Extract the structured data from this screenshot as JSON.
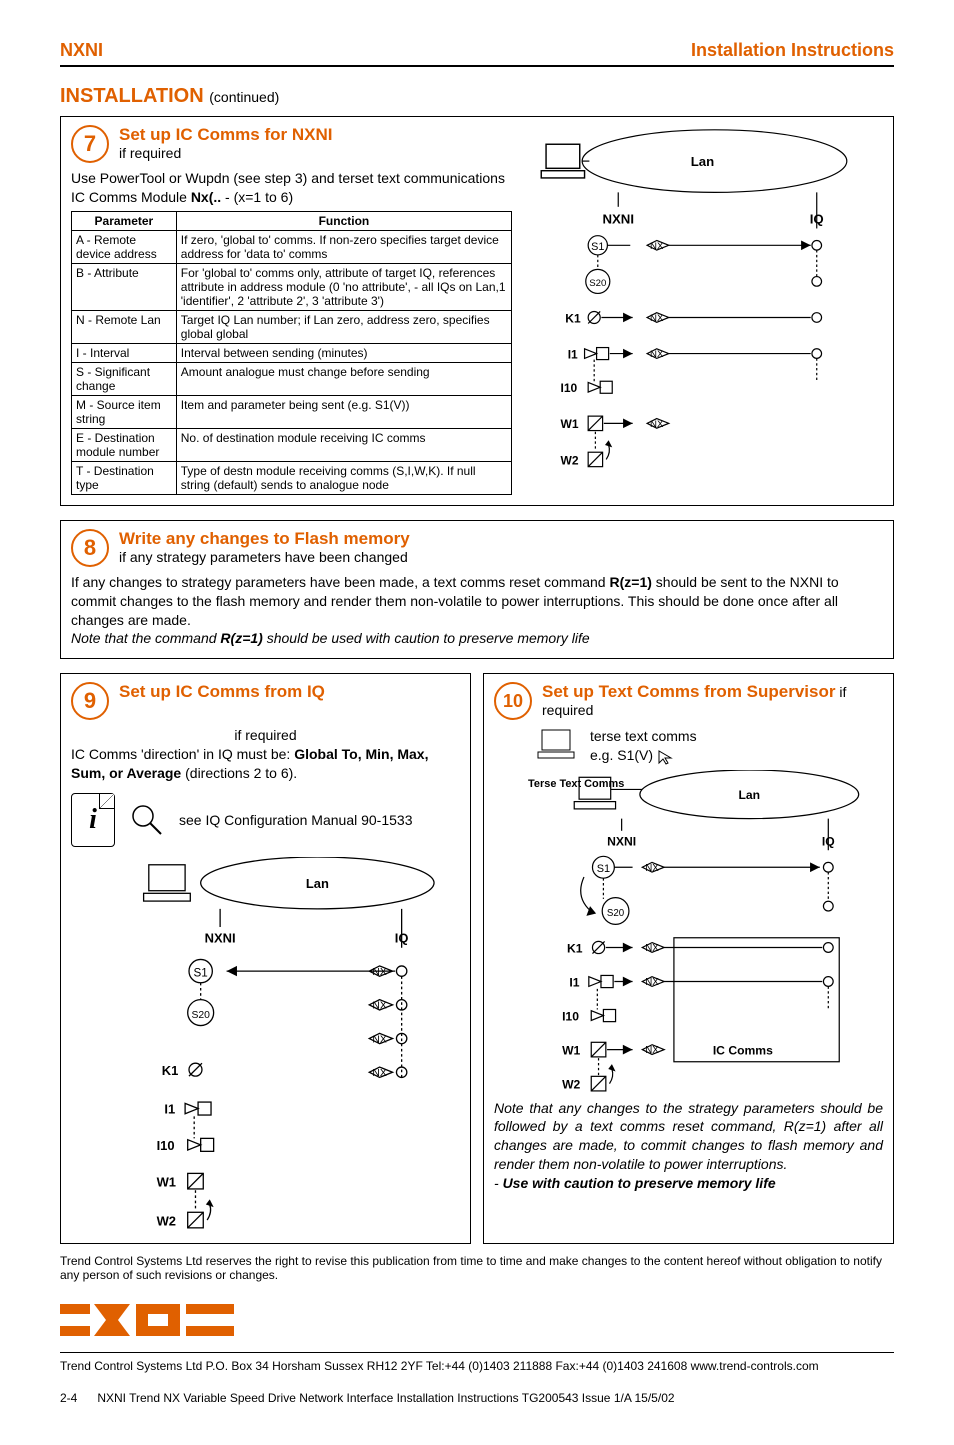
{
  "header": {
    "left": "NXNI",
    "right": "Installation Instructions"
  },
  "install_title": "INSTALLATION",
  "install_cont": "(continued)",
  "step7": {
    "num": "7",
    "title": "Set up IC Comms for NXNI",
    "sub": "if required",
    "intro1": "Use PowerTool or Wupdn (see step 3) and terset text communications IC Comms Module ",
    "intro2": "Nx(..",
    "intro3": " - (x=1 to 6)",
    "th1": "Parameter",
    "th2": "Function",
    "rows": [
      {
        "p": "A - Remote device address",
        "f": "If zero, 'global to' comms. If non-zero specifies target device address for 'data to' comms"
      },
      {
        "p": "B - Attribute",
        "f": "For 'global to' comms only, attribute of target IQ, references attribute in address module (0 'no attribute', - all IQs on Lan,1 'identifier', 2 'attribute 2', 3 'attribute 3')"
      },
      {
        "p": "N - Remote Lan",
        "f": "Target IQ Lan number; if Lan zero, address zero, specifies global global"
      },
      {
        "p": "I - Interval",
        "f": "Interval between sending (minutes)"
      },
      {
        "p": "S - Significant change",
        "f": "Amount analogue must change before sending"
      },
      {
        "p": "M - Source item string",
        "f": "Item and parameter being sent (e.g. S1(V))"
      },
      {
        "p": "E - Destination module number",
        "f": "No. of destination module receiving IC comms"
      },
      {
        "p": "T - Destination type",
        "f": "Type of destn module receiving comms (S,I,W,K). If null string (default) sends to analogue node"
      }
    ]
  },
  "step8": {
    "num": "8",
    "title": "Write any changes to Flash memory",
    "sub": "if any strategy parameters have been changed",
    "p1a": "If any changes to strategy parameters have been made, a text comms reset command ",
    "p1b": "R(z=1)",
    "p1c": " should be sent to the NXNI to commit changes to the flash memory and render them non-volatile to power interruptions. This should be done once after all changes are made.",
    "p2a": "Note that the command ",
    "p2b": "R(z=1)",
    "p2c": " should be used with caution to preserve memory life"
  },
  "step9": {
    "num": "9",
    "title": "Set up IC Comms from IQ",
    "sub": "if required",
    "l1a": "IC Comms 'direction' in IQ must be: ",
    "l1b": "Global To, Min, Max, Sum, or Average",
    "l1c": " (directions 2 to 6).",
    "ref": "see IQ Configuration Manual 90-1533"
  },
  "step10": {
    "num": "10",
    "title": "Set up Text Comms from Supervisor",
    "sub": " if required",
    "l1": "terse text comms",
    "l2": "e.g. S1(V)",
    "note1": "Note that any changes to the strategy parameters should be followed by a text comms reset command, R(z=1) after all changes are made, to commit changes to flash memory and render them non-volatile to power interruptions.",
    "note2": "- ",
    "note2b": "Use with caution to preserve memory life"
  },
  "disclaimer": "Trend Control Systems Ltd reserves the right to revise this publication from time to time and make changes to the content hereof without obligation to notify any person of such revisions or changes.",
  "footer_addr": "Trend Control Systems Ltd P.O. Box 34 Horsham Sussex RH12 2YF Tel:+44 (0)1403 211888 Fax:+44 (0)1403 241608 www.trend-controls.com",
  "footer_page": "2-4",
  "footer_doc": "NXNI Trend NX Variable Speed Drive Network Interface Installation Instructions TG200543 Issue 1/A 15/5/02",
  "diagram": {
    "lan": "Lan",
    "nxni": "NXNI",
    "iq": "IQ",
    "s1": "S1",
    "s20": "S20",
    "k1": "K1",
    "i1": "I1",
    "i10": "I10",
    "w1": "W1",
    "w2": "W2",
    "nx": "NX",
    "terse": "Terse Text Comms",
    "ic_comms": "IC Comms"
  }
}
